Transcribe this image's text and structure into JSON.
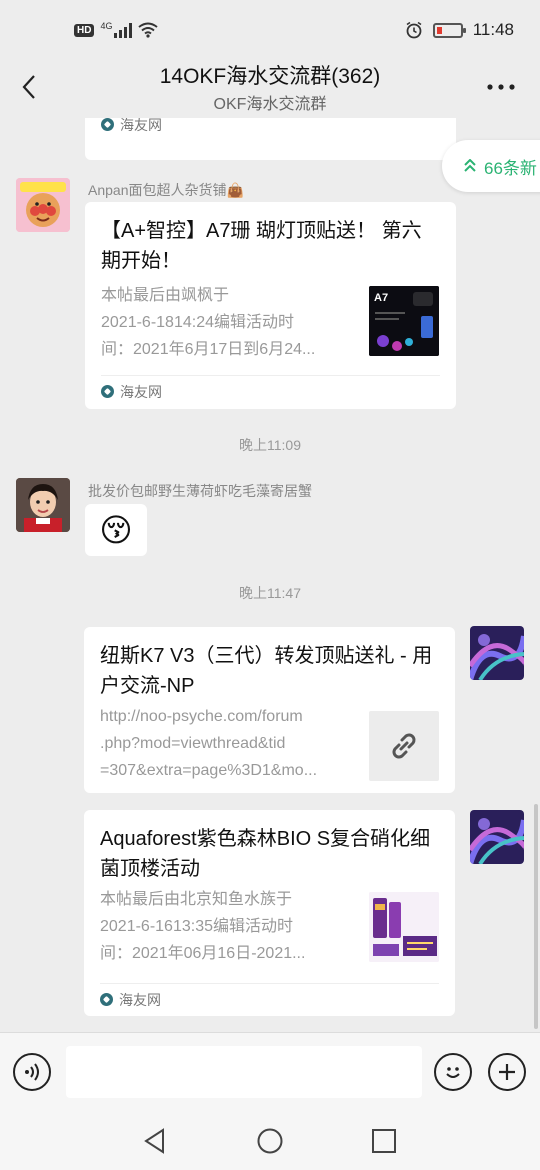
{
  "status": {
    "hd": "HD",
    "network": "4G",
    "time": "11:48"
  },
  "header": {
    "title": "14OKF海水交流群(362)",
    "subtitle": "OKF海水交流群"
  },
  "new_messages": {
    "label": "66条新"
  },
  "messages": [
    {
      "card_source": "海友网"
    },
    {
      "sender": "Anpan面包超人杂货铺👜",
      "card_title": "【A+智控】A7珊 瑚灯顶贴送！ 第六期开始！",
      "card_desc": [
        "本帖最后由飒枫于",
        "2021-6-1814:24编辑活动时",
        "间：2021年6月17日到6月24..."
      ],
      "card_source": "海友网"
    },
    {
      "timestamp": "晚上11:09"
    },
    {
      "sender": "批发价包邮野生薄荷虾吃毛藻寄居蟹",
      "emoji": "😚"
    },
    {
      "timestamp": "晚上11:47"
    },
    {
      "card_title": "纽斯K7 V3（三代）转发顶贴送礼 - 用户交流-NP",
      "card_desc": [
        "http://noo-psyche.com/forum",
        ".php?mod=viewthread&tid",
        "=307&extra=page%3D1&mo..."
      ]
    },
    {
      "card_title": "Aquaforest紫色森林BIO S复合硝化细菌顶楼活动",
      "card_desc": [
        "本帖最后由北京知鱼水族于",
        "2021-6-1613:35编辑活动时",
        "间：2021年06月16日-2021..."
      ],
      "card_source": "海友网"
    }
  ],
  "thumb_text": {
    "a7": "A7"
  },
  "colors": {
    "accent_green": "#2bb373",
    "background": "#ededed",
    "card": "#ffffff"
  }
}
